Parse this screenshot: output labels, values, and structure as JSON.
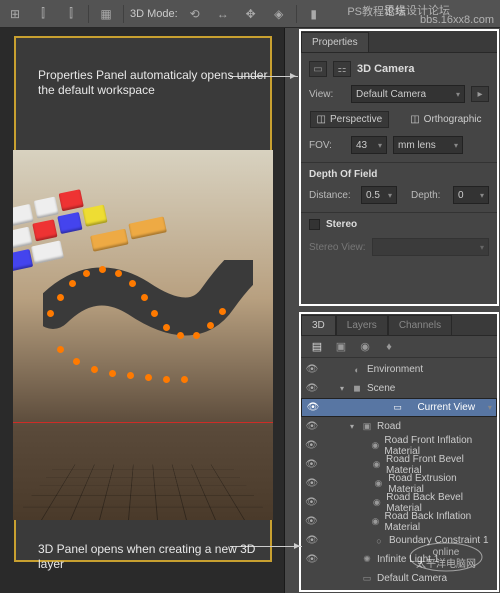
{
  "toolbar": {
    "mode_label": "3D Mode:"
  },
  "watermarks": {
    "w1": "思缘设计论坛",
    "w2": "PS教程论坛",
    "w3": "bbs.16xx8.com",
    "w4": "太平洋电脑网",
    "w5": "online"
  },
  "annotations": {
    "note1": "Properties Panel automaticaly opens under the default workspace",
    "note2": "3D Panel opens when creating a new 3D layer"
  },
  "properties": {
    "tab": "Properties",
    "title": "3D Camera",
    "view_label": "View:",
    "view_value": "Default Camera",
    "perspective": "Perspective",
    "orthographic": "Orthographic",
    "fov_label": "FOV:",
    "fov_value": "43",
    "fov_unit": "mm lens",
    "dof_title": "Depth Of Field",
    "distance_label": "Distance:",
    "distance_value": "0.5",
    "depth_label": "Depth:",
    "depth_value": "0",
    "stereo": "Stereo",
    "stereo_view": "Stereo View:"
  },
  "panel3d": {
    "tabs": [
      "3D",
      "Layers",
      "Channels"
    ],
    "items": [
      {
        "label": "Environment",
        "ind": 1,
        "eye": true,
        "tw": "",
        "ic": "◐"
      },
      {
        "label": "Scene",
        "ind": 1,
        "eye": true,
        "tw": "▾",
        "ic": "◼"
      },
      {
        "label": "Current View",
        "ind": 2,
        "eye": true,
        "tw": "",
        "ic": "▭",
        "sel": true
      },
      {
        "label": "Road",
        "ind": 2,
        "eye": true,
        "tw": "▾",
        "ic": "▣"
      },
      {
        "label": "Road Front Inflation Material",
        "ind": 3,
        "eye": true,
        "tw": "",
        "ic": "◉"
      },
      {
        "label": "Road Front Bevel Material",
        "ind": 3,
        "eye": true,
        "tw": "",
        "ic": "◉"
      },
      {
        "label": "Road Extrusion Material",
        "ind": 3,
        "eye": true,
        "tw": "",
        "ic": "◉"
      },
      {
        "label": "Road Back Bevel Material",
        "ind": 3,
        "eye": true,
        "tw": "",
        "ic": "◉"
      },
      {
        "label": "Road Back Inflation Material",
        "ind": 3,
        "eye": true,
        "tw": "",
        "ic": "◉"
      },
      {
        "label": "Boundary Constraint 1",
        "ind": 3,
        "eye": true,
        "tw": "",
        "ic": "○"
      },
      {
        "label": "Infinite Light 1",
        "ind": 2,
        "eye": true,
        "tw": "",
        "ic": "✺"
      },
      {
        "label": "Default Camera",
        "ind": 2,
        "eye": false,
        "tw": "",
        "ic": "▭"
      }
    ]
  }
}
